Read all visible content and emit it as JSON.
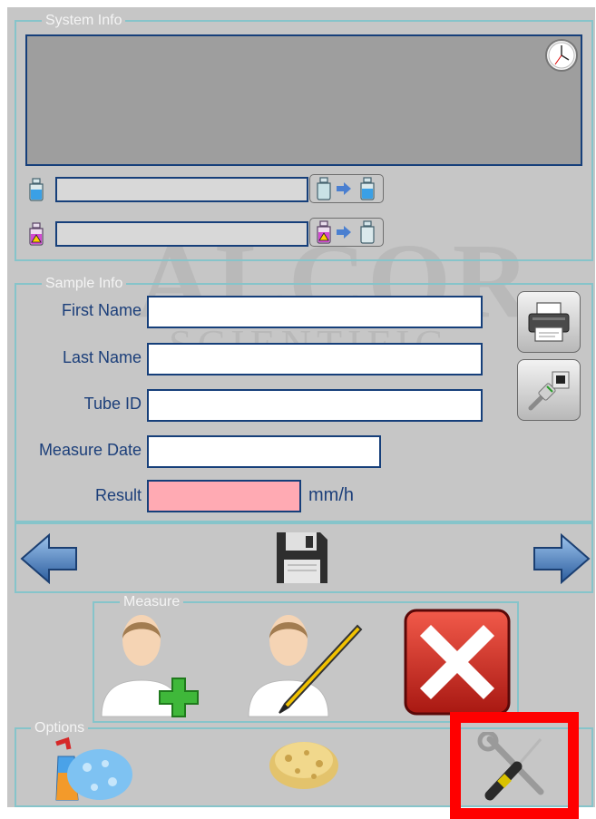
{
  "system_info": {
    "legend": "System Info",
    "clock_icon": "clock-icon",
    "reagent_icon": "blue-bottle-icon",
    "waste_icon": "pink-bottle-icon",
    "reagent_transfer_icon": "bottle-transfer-icon",
    "waste_transfer_icon": "waste-transfer-icon"
  },
  "watermark": {
    "line1": "ALCOR",
    "line2": "SCIENTIFIC"
  },
  "sample_info": {
    "legend": "Sample Info",
    "first_name_label": "First Name",
    "first_name_value": "",
    "last_name_label": "Last Name",
    "last_name_value": "",
    "tube_id_label": "Tube ID",
    "tube_id_value": "",
    "measure_date_label": "Measure Date",
    "measure_date_value": "",
    "result_label": "Result",
    "result_value": "",
    "result_unit": "mm/h",
    "print_icon": "printer-icon",
    "network_icon": "network-cable-icon"
  },
  "navigation": {
    "prev_icon": "arrow-left-icon",
    "save_icon": "floppy-disk-icon",
    "next_icon": "arrow-right-icon"
  },
  "measure": {
    "legend": "Measure",
    "add_icon": "add-person-icon",
    "edit_icon": "edit-person-icon",
    "cancel_icon": "cancel-x-icon"
  },
  "options": {
    "legend": "Options",
    "clean_icon": "spray-sponge-icon",
    "sponge_icon": "sponge-icon",
    "tools_icon": "wrench-screwdriver-icon"
  },
  "colors": {
    "panel": "#c6c6c6",
    "border": "#86c4ca",
    "field_border": "#163f7a",
    "label_text": "#1c3f7a",
    "result_field": "#ffaab3",
    "highlight": "#ff0000"
  }
}
